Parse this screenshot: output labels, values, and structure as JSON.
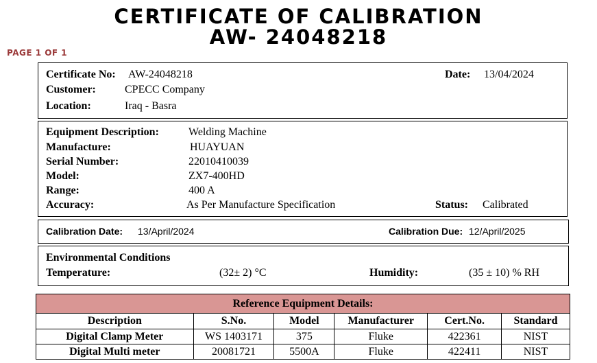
{
  "header": {
    "title_line1": "CERTIFICATE OF CALIBRATION",
    "title_line2": "AW- 24048218",
    "page_label": "PAGE 1 OF 1"
  },
  "certificate": {
    "cert_no_label": "Certificate No:",
    "cert_no": "AW-24048218",
    "date_label": "Date:",
    "date": "13/04/2024",
    "customer_label": "Customer:",
    "customer": "CPECC Company",
    "location_label": "Location:",
    "location": "Iraq - Basra"
  },
  "equipment": {
    "description_label": "Equipment Description:",
    "description": "Welding Machine",
    "manufacture_label": "Manufacture:",
    "manufacture": "HUAYUAN",
    "serial_label": "Serial Number:",
    "serial": "22010410039",
    "model_label": "Model:",
    "model": "ZX7-400HD",
    "range_label": "Range:",
    "range": "400 A",
    "accuracy_label": "Accuracy:",
    "accuracy": "As Per Manufacture Specification",
    "status_label": "Status:",
    "status": "Calibrated"
  },
  "calibration": {
    "date_label": "Calibration Date:",
    "date": "13/April/2024",
    "due_label": "Calibration Due:",
    "due": "12/April/2025"
  },
  "environment": {
    "heading": "Environmental Conditions",
    "temperature_label": "Temperature:",
    "temperature": "(32± 2) °C",
    "humidity_label": "Humidity:",
    "humidity": "(35 ± 10) % RH"
  },
  "reference": {
    "title": "Reference Equipment Details:",
    "columns": [
      "Description",
      "S.No.",
      "Model",
      "Manufacturer",
      "Cert.No.",
      "Standard"
    ],
    "rows": [
      [
        "Digital Clamp Meter",
        "WS 1403171",
        "375",
        "Fluke",
        "422361",
        "NIST"
      ],
      [
        "Digital Multi meter",
        "20081721",
        "5500A",
        "Fluke",
        "422411",
        "NIST"
      ]
    ]
  }
}
